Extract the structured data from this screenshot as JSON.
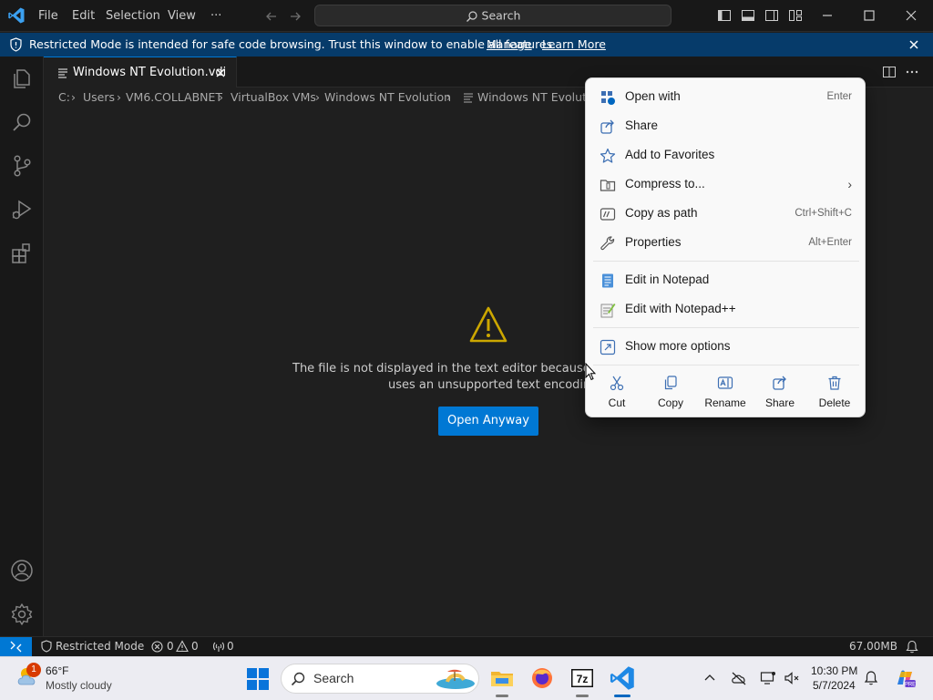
{
  "titlebar": {
    "menu": [
      "File",
      "Edit",
      "Selection",
      "View",
      "···"
    ],
    "search_placeholder": "Search"
  },
  "banner": {
    "text": "Restricted Mode is intended for safe code browsing. Trust this window to enable all features.",
    "manage": "Manage",
    "learn_more": "Learn More"
  },
  "tab": {
    "label": "Windows NT Evolution.vdi"
  },
  "breadcrumb": [
    "C:",
    "Users",
    "VM6.COLLABNET",
    "VirtualBox VMs",
    "Windows NT Evolution",
    "Windows NT Evolutio"
  ],
  "editor": {
    "message_line1": "The file is not displayed in the text editor because it",
    "message_line2": "uses an unsupported text encoding",
    "open_anyway": "Open Anyway"
  },
  "context_menu": {
    "items": [
      {
        "label": "Open with",
        "shortcut": "Enter",
        "icon": "open-with-icon"
      },
      {
        "label": "Share",
        "shortcut": "",
        "icon": "share-icon"
      },
      {
        "label": "Add to Favorites",
        "shortcut": "",
        "icon": "star-icon"
      },
      {
        "label": "Compress to...",
        "shortcut": "",
        "icon": "archive-icon"
      },
      {
        "label": "Copy as path",
        "shortcut": "Ctrl+Shift+C",
        "icon": "copy-path-icon"
      },
      {
        "label": "Properties",
        "shortcut": "Alt+Enter",
        "icon": "wrench-icon"
      },
      {
        "label": "Edit in Notepad",
        "shortcut": "",
        "icon": "notepad-icon"
      },
      {
        "label": "Edit with Notepad++",
        "shortcut": "",
        "icon": "notepadpp-icon"
      },
      {
        "label": "Show more options",
        "shortcut": "",
        "icon": "more-options-icon"
      }
    ],
    "quick_actions": [
      "Cut",
      "Copy",
      "Rename",
      "Share",
      "Delete"
    ]
  },
  "statusbar": {
    "restricted_mode": "Restricted Mode",
    "errors": "0",
    "warnings": "0",
    "ports": "0",
    "memory": "67.00MB"
  },
  "taskbar": {
    "weather_temp": "66°F",
    "weather_desc": "Mostly cloudy",
    "weather_badge": "1",
    "search": "Search",
    "time": "10:30 PM",
    "date": "5/7/2024"
  },
  "colors": {
    "accent": "#0078d4",
    "banner": "#063b6a",
    "warning": "#cca700"
  }
}
